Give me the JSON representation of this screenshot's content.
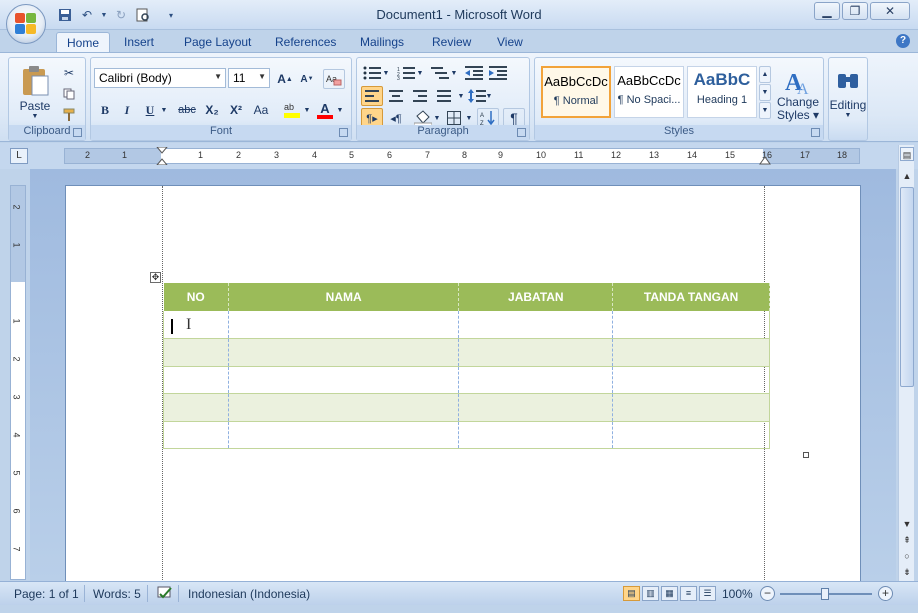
{
  "window": {
    "title": "Document1 - Microsoft Word"
  },
  "quick_access": {
    "icons": [
      "save-icon",
      "undo-icon",
      "redo-icon",
      "print-preview-icon",
      "customize-icon"
    ]
  },
  "tabs": [
    "Home",
    "Insert",
    "Page Layout",
    "References",
    "Mailings",
    "Review",
    "View"
  ],
  "active_tab": "Home",
  "ribbon": {
    "clipboard": {
      "label": "Clipboard",
      "paste_label": "Paste"
    },
    "font": {
      "label": "Font",
      "font_name": "Calibri (Body)",
      "font_size": "11",
      "bold": "B",
      "italic": "I",
      "underline": "U",
      "strikethrough": "abc",
      "subscript": "X₂",
      "superscript": "X²",
      "change_case": "Aa",
      "font_color_glyph": "A"
    },
    "paragraph": {
      "label": "Paragraph"
    },
    "styles": {
      "label": "Styles",
      "items": [
        {
          "sample": "AaBbCcDc",
          "name": "¶ Normal"
        },
        {
          "sample": "AaBbCcDc",
          "name": "¶ No Spaci..."
        },
        {
          "sample": "AaBbC",
          "name": "Heading 1"
        }
      ],
      "change_styles_line1": "Change",
      "change_styles_line2": "Styles ▾"
    },
    "editing": {
      "label": "Editing"
    }
  },
  "ruler": {
    "numbers": [
      "2",
      "1",
      "1",
      "2",
      "3",
      "4",
      "5",
      "6",
      "7",
      "8",
      "9",
      "10",
      "11",
      "12",
      "13",
      "14",
      "15",
      "16",
      "17",
      "18"
    ],
    "vertical_numbers": [
      "2",
      "1",
      "1",
      "2",
      "3",
      "4",
      "5",
      "6",
      "7"
    ]
  },
  "document": {
    "table": {
      "headers": [
        "NO",
        "NAMA",
        "JABATAN",
        "TANDA TANGAN"
      ],
      "rows": 5,
      "header_color": "#9bbb59",
      "band_color": "#ebf1de"
    }
  },
  "status_bar": {
    "page": "Page: 1 of 1",
    "words": "Words: 5",
    "language": "Indonesian (Indonesia)",
    "zoom": "100%"
  }
}
